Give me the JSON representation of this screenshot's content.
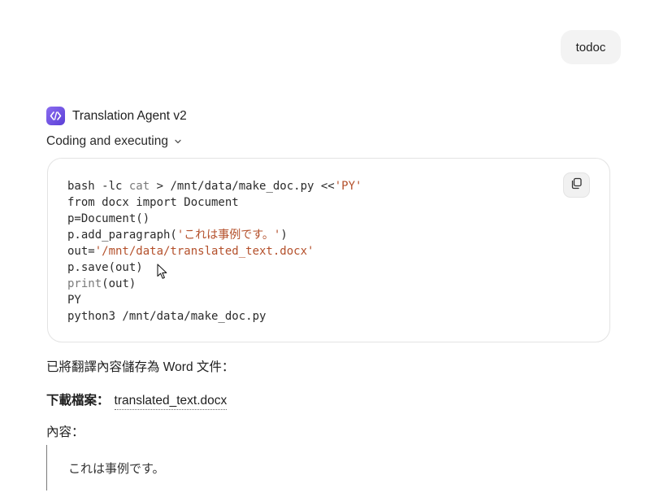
{
  "user_message": {
    "text": "todoc"
  },
  "agent": {
    "name": "Translation Agent v2",
    "status": "Coding and executing"
  },
  "code": {
    "lines": [
      [
        {
          "t": "bash -lc ",
          "c": ""
        },
        {
          "t": "cat",
          "c": "kw"
        },
        {
          "t": " > /mnt/data/make_doc.py <<",
          "c": ""
        },
        {
          "t": "'PY'",
          "c": "str"
        }
      ],
      [
        {
          "t": "from docx import Document",
          "c": ""
        }
      ],
      [
        {
          "t": "p=Document()",
          "c": ""
        }
      ],
      [
        {
          "t": "p.add_paragraph(",
          "c": ""
        },
        {
          "t": "'これは事例です。'",
          "c": "str"
        },
        {
          "t": ")",
          "c": ""
        }
      ],
      [
        {
          "t": "out=",
          "c": ""
        },
        {
          "t": "'/mnt/data/translated_text.docx'",
          "c": "str"
        }
      ],
      [
        {
          "t": "p.save(out)",
          "c": ""
        }
      ],
      [
        {
          "t": "print",
          "c": "kw"
        },
        {
          "t": "(out)",
          "c": ""
        }
      ],
      [
        {
          "t": "PY",
          "c": ""
        }
      ],
      [
        {
          "t": "python3 /mnt/data/make_doc.py",
          "c": ""
        }
      ]
    ]
  },
  "response": {
    "saved_note": "已將翻譯內容儲存為 Word 文件：",
    "download_label": "下載檔案：",
    "download_link": "translated_text.docx",
    "content_label": "內容：",
    "quote_text": "これは事例です。"
  }
}
